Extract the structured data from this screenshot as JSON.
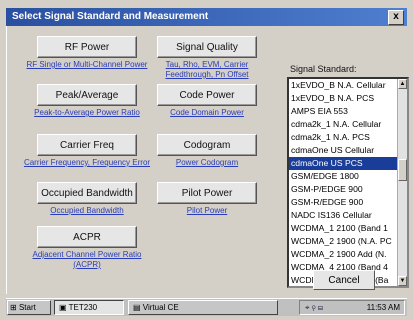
{
  "window": {
    "title": "Select Signal Standard and Measurement",
    "close_label": "x"
  },
  "measurements": [
    {
      "button": "RF Power",
      "link": "RF Single or Multi-Channel Power"
    },
    {
      "button": "Signal Quality",
      "link": "Tau, Rho, EVM, Carrier Feedthrough, Pn Offset"
    },
    {
      "button": "Peak/Average",
      "link": "Peak-to-Average Power Ratio"
    },
    {
      "button": "Code Power",
      "link": "Code Domain Power"
    },
    {
      "button": "Carrier Freq",
      "link": "Carrier Frequency, Frequency Error"
    },
    {
      "button": "Codogram",
      "link": "Power Codogram"
    },
    {
      "button": "Occupied Bandwidth",
      "link": "Occupied Bandwidth"
    },
    {
      "button": "Pilot Power",
      "link": "Pilot Power"
    },
    {
      "button": "ACPR",
      "link": "Adjacent Channel Power Ratio (ACPR)"
    }
  ],
  "signal_standard": {
    "label": "Signal Standard:",
    "items": [
      "1xEVDO_B N.A. Cellular",
      "1xEVDO_B N.A. PCS",
      "AMPS EIA 553",
      "cdma2k_1 N.A. Cellular",
      "cdma2k_1 N.A. PCS",
      "cdmaOne US Cellular",
      "cdmaOne US PCS",
      "GSM/EDGE 1800",
      "GSM-P/EDGE 900",
      "GSM-R/EDGE 900",
      "NADC IS136 Cellular",
      "WCDMA_1 2100 (Band 1",
      "WCDMA_2 1900 (N.A. PC",
      "WCDMA_2 1900 Add (N.",
      "WCDMA_4 2100 (Band 4",
      "WCDMA_4 2100 Add (Ba"
    ],
    "selected_index": 6
  },
  "cancel_label": "Cancel",
  "taskbar": {
    "start": "Start",
    "task1": "TET230",
    "task2": "Virtual CE",
    "clock": "11:53 AM"
  }
}
